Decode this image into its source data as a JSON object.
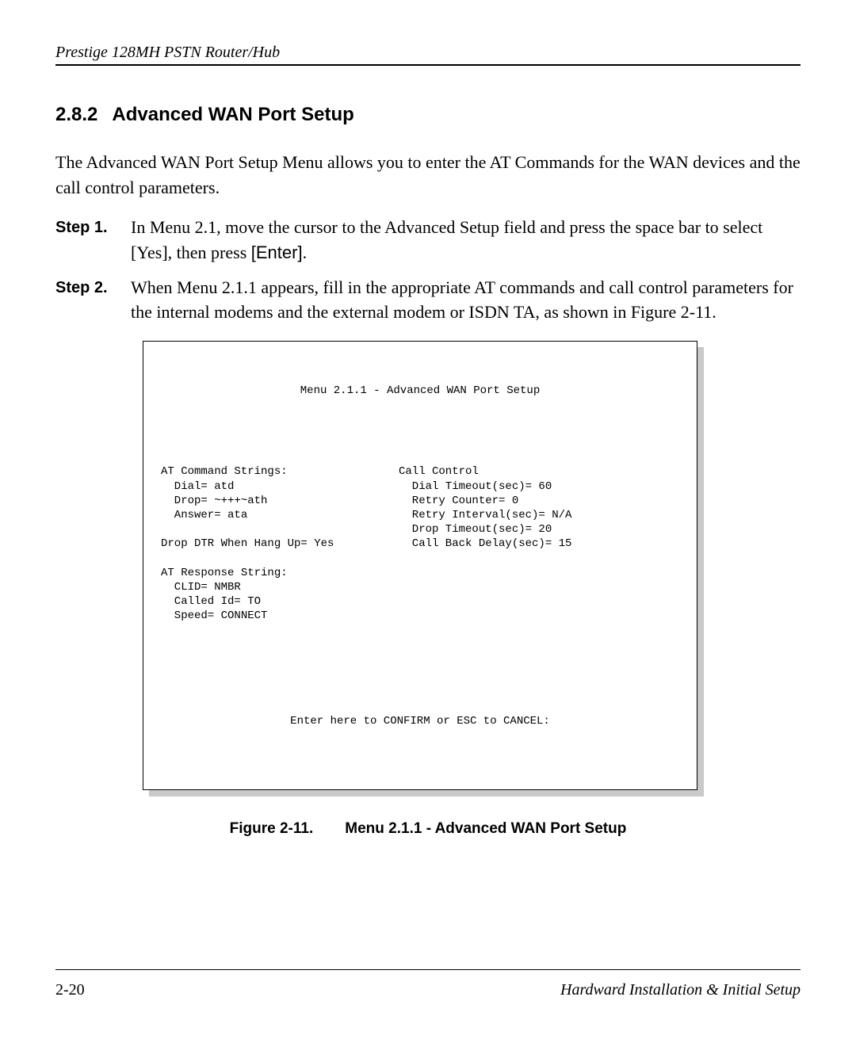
{
  "header": {
    "title": "Prestige 128MH  PSTN Router/Hub"
  },
  "section": {
    "number": "2.8.2",
    "title": "Advanced WAN Port Setup"
  },
  "intro": "The Advanced WAN Port Setup Menu allows you to enter the AT Commands for the WAN devices and the call control parameters.",
  "steps": [
    {
      "label": "Step 1.",
      "text_a": "In Menu 2.1, move the cursor to the Advanced Setup field and press the space bar to select [Yes], then press ",
      "enter": "[Enter]",
      "text_b": "."
    },
    {
      "label": "Step 2.",
      "text_a": "When Menu 2.1.1 appears, fill in the appropriate AT commands and call control parameters for the internal modems and the external modem or ISDN TA, as shown in Figure 2-11.",
      "enter": "",
      "text_b": ""
    }
  ],
  "terminal": {
    "title": "Menu 2.1.1 - Advanced WAN Port Setup",
    "left_block1_title": "AT Command Strings:",
    "left_dial": "  Dial= atd",
    "left_drop": "  Drop= ~+++~ath",
    "left_answer": "  Answer= ata",
    "left_blank": "",
    "left_dtr": "Drop DTR When Hang Up= Yes",
    "left_resp_title": "AT Response String:",
    "left_clid": "  CLID= NMBR",
    "left_called": "  Called Id= TO",
    "left_speed": "  Speed= CONNECT",
    "right_title": "Call Control",
    "right_dialto": "  Dial Timeout(sec)= 60",
    "right_retryc": "  Retry Counter= 0",
    "right_retryi": "  Retry Interval(sec)= N/A",
    "right_dropto": "  Drop Timeout(sec)= 20",
    "right_cbdelay": "  Call Back Delay(sec)= 15",
    "footer": "Enter here to CONFIRM or ESC to CANCEL:"
  },
  "figure": {
    "label": "Figure 2-11.",
    "caption": "Menu 2.1.1 - Advanced WAN Port Setup"
  },
  "footer": {
    "page": "2-20",
    "section": "Hardward Installation & Initial Setup"
  }
}
